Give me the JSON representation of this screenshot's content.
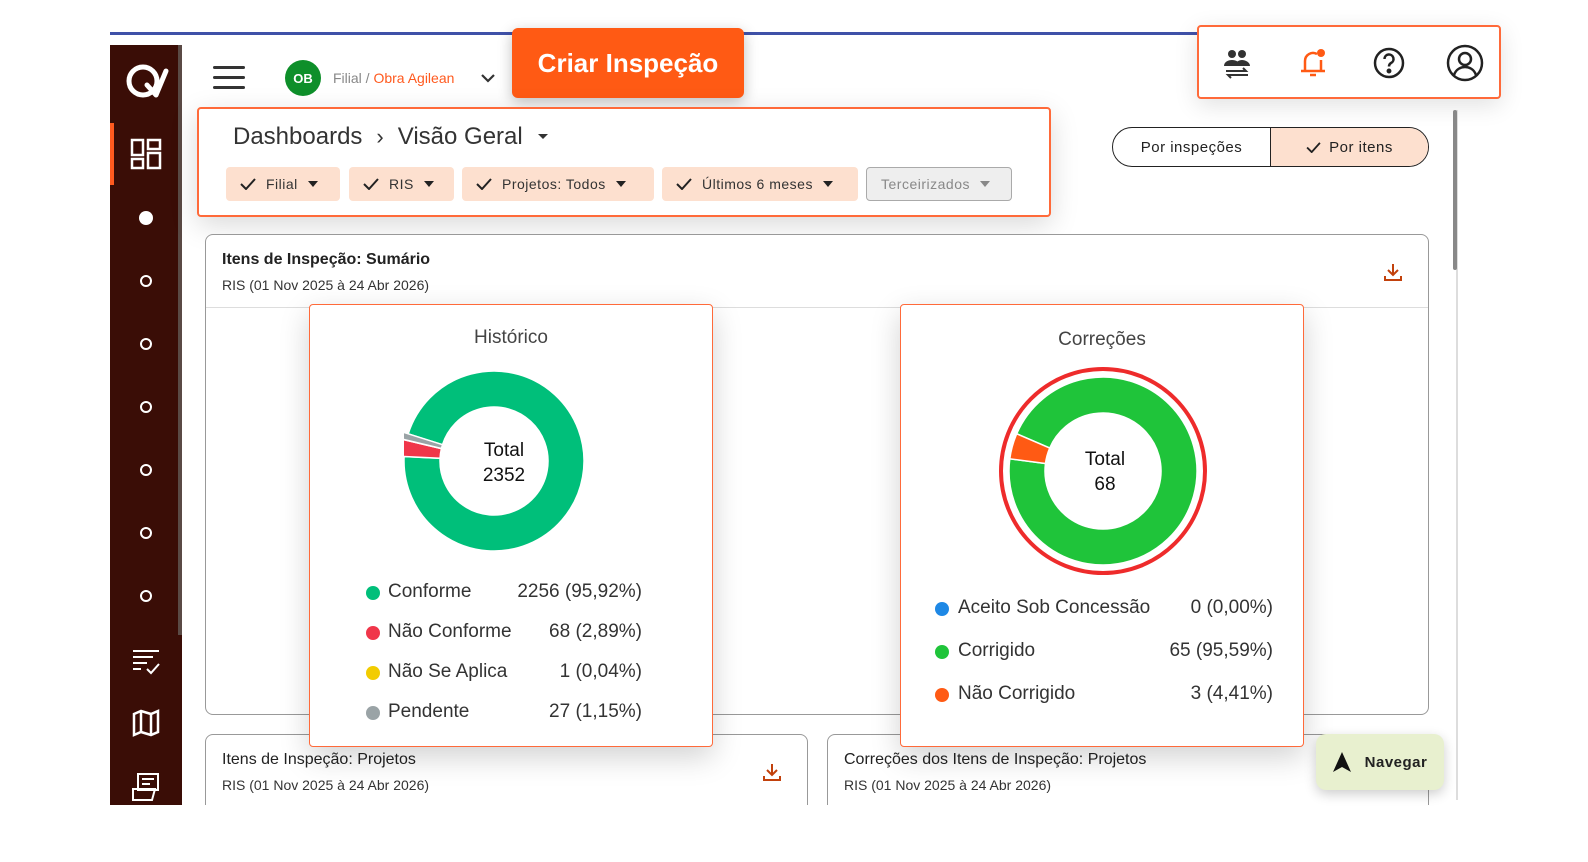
{
  "header": {
    "avatar_initials": "OB",
    "filial_label": "Filial /",
    "obra_label": "Obra Agilean",
    "create_button": "Criar Inspeção"
  },
  "icons": {
    "top_icons": [
      "users-swap-icon",
      "bell-alert-icon",
      "help-icon",
      "account-icon"
    ],
    "accent": "#ff5a14",
    "sidebar_bg": "#3a0d06"
  },
  "breadcrumb": {
    "root": "Dashboards",
    "current": "Visão Geral"
  },
  "filters": [
    {
      "label": "Filial",
      "enabled": true
    },
    {
      "label": "RIS",
      "enabled": true
    },
    {
      "label": "Projetos: Todos",
      "enabled": true
    },
    {
      "label": "Últimos 6 meses",
      "enabled": true
    },
    {
      "label": "Terceirizados",
      "enabled": false
    }
  ],
  "view_toggle": {
    "option_a": "Por inspeções",
    "option_b": "Por itens",
    "selected": "Por itens"
  },
  "summary_panel": {
    "title": "Itens de Inspeção: Sumário",
    "subtitle": "RIS (01 Nov 2025 à 24 Abr 2026)"
  },
  "historico": {
    "title": "Histórico",
    "total_label": "Total",
    "total_value": "2352",
    "legend": [
      {
        "label": "Conforme",
        "value": "2256 (95,92%)",
        "color": "#00bf7a"
      },
      {
        "label": "Não Conforme",
        "value": "68 (2,89%)",
        "color": "#f0364a"
      },
      {
        "label": "Não Se Aplica",
        "value": "1 (0,04%)",
        "color": "#f2cc00"
      },
      {
        "label": "Pendente",
        "value": "27 (1,15%)",
        "color": "#9aa3a6"
      }
    ]
  },
  "correcoes": {
    "title": "Correções",
    "total_label": "Total",
    "total_value": "68",
    "legend": [
      {
        "label": "Aceito Sob Concessão",
        "value": "0 (0,00%)",
        "color": "#1e88e5"
      },
      {
        "label": "Corrigido",
        "value": "65 (95,59%)",
        "color": "#1fc43a"
      },
      {
        "label": "Não Corrigido",
        "value": "3 (4,41%)",
        "color": "#ff5a14"
      }
    ]
  },
  "chart_data": [
    {
      "type": "pie",
      "title": "Histórico",
      "categories": [
        "Conforme",
        "Não Conforme",
        "Não Se Aplica",
        "Pendente"
      ],
      "values": [
        2256,
        68,
        1,
        27
      ],
      "colors": [
        "#00bf7a",
        "#f0364a",
        "#f2cc00",
        "#9aa3a6"
      ]
    },
    {
      "type": "pie",
      "title": "Correções",
      "categories": [
        "Aceito Sob Concessão",
        "Corrigido",
        "Não Corrigido"
      ],
      "values": [
        0,
        65,
        3
      ],
      "colors": [
        "#1e88e5",
        "#1fc43a",
        "#ff5a14"
      ]
    }
  ],
  "projetos_panel": {
    "title": "Itens de Inspeção: Projetos",
    "subtitle": "RIS (01 Nov 2025 à 24 Abr 2026)"
  },
  "correcoes_projetos_panel": {
    "title": "Correções dos Itens de Inspeção: Projetos",
    "subtitle": "RIS (01 Nov 2025 à 24 Abr 2026)"
  },
  "navegar": {
    "label": "Navegar"
  }
}
